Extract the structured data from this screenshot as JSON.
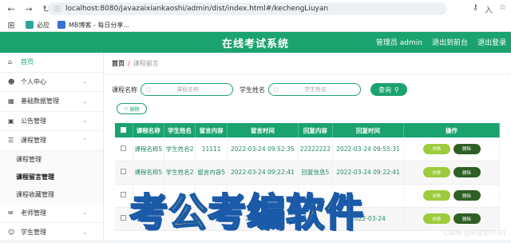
{
  "browser": {
    "url": "localhost:8080/javazaixiankaoshi/admin/dist/index.html#/kechengLiuyan",
    "bookmarks": [
      "必应",
      "MB博客 - 每日分享..."
    ]
  },
  "header": {
    "title": "在线考试系统",
    "links": [
      "管理员 admin",
      "退出到前台",
      "退出登录"
    ]
  },
  "sidebar": {
    "items": [
      {
        "label": "首页",
        "icon": "home-icon"
      },
      {
        "label": "个人中心",
        "icon": "user-icon"
      },
      {
        "label": "基础数据管理",
        "icon": "table-icon"
      },
      {
        "label": "公告管理",
        "icon": "notice-icon"
      },
      {
        "label": "课程管理",
        "icon": "settings-icon"
      }
    ],
    "submenus": [
      "课程管理",
      "课程留言管理",
      "课程收藏管理"
    ],
    "after": [
      {
        "label": "老师管理",
        "icon": "teacher-icon"
      },
      {
        "label": "学生管理",
        "icon": "student-icon"
      }
    ]
  },
  "breadcrumb": {
    "home": "首页",
    "current": "课程留言"
  },
  "search": {
    "label1": "课程名称",
    "ph1": "课程名称",
    "label2": "学生姓名",
    "ph2": "学生姓名",
    "button": "查询"
  },
  "delete_all": "删除",
  "table": {
    "headers": [
      "课程名称",
      "学生姓名",
      "留言内容",
      "留言时间",
      "回复内容",
      "回复时间",
      "操作"
    ],
    "rows": [
      [
        "课程名称5",
        "学生姓名2",
        "11111",
        "2022-03-24 09:52:35",
        "22222222",
        "2022-03-24 09:55:31"
      ],
      [
        "课程名称5",
        "学生姓名2",
        "留言内容5",
        "2022-03-24 09:22:41",
        "回复信息5",
        "2022-03-24 09:22:41"
      ],
      [
        "",
        "",
        "",
        "",
        "",
        ""
      ],
      [
        "",
        "",
        "",
        "2022-03-24",
        "",
        "2022-03-24"
      ]
    ],
    "view_label": "详情",
    "del_label": "删除"
  },
  "overlay_text": "考公考编软件",
  "watermark": "CSDN @毕业设计-01",
  "colors": {
    "accent": "#1aa36e"
  }
}
